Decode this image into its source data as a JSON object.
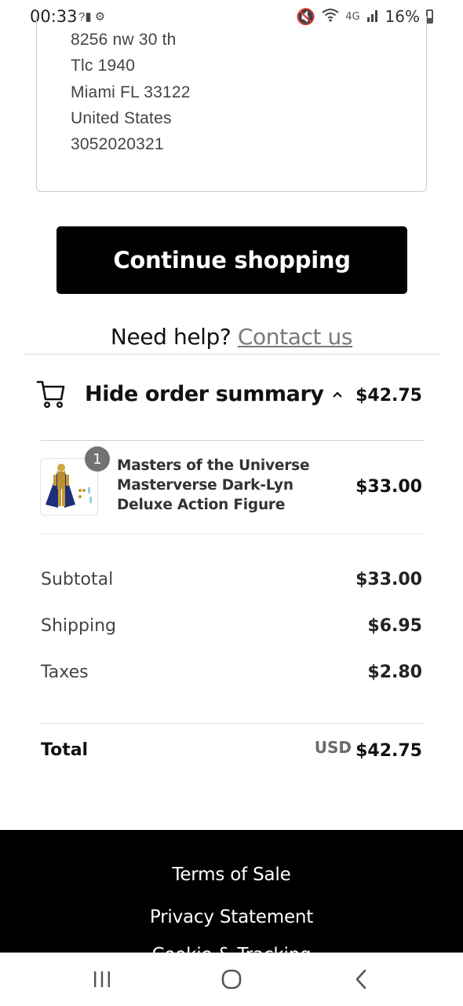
{
  "status_bar": {
    "time": "00:33",
    "battery": "16%",
    "network": "4G"
  },
  "address": {
    "lines": [
      "8256 nw 30 th",
      "Tlc 1940",
      "Miami FL 33122",
      "United States",
      "3052020321"
    ]
  },
  "continue_button": {
    "label": "Continue shopping"
  },
  "help": {
    "prefix": "Need help?",
    "link": "Contact us"
  },
  "order_summary": {
    "toggle_label": "Hide order summary",
    "total": "$42.75"
  },
  "product": {
    "quantity": "1",
    "name": "Masters of the Universe Masterverse Dark-Lyn Deluxe Action Figure",
    "price": "$33.00"
  },
  "totals": {
    "subtotal_label": "Subtotal",
    "subtotal_value": "$33.00",
    "shipping_label": "Shipping",
    "shipping_value": "$6.95",
    "taxes_label": "Taxes",
    "taxes_value": "$2.80",
    "total_label": "Total",
    "currency": "USD",
    "total_value": "$42.75"
  },
  "footer": {
    "links": [
      "Terms of Sale",
      "Privacy Statement",
      "Cookie & Tracking"
    ]
  },
  "colors": {
    "button_bg": "#000000",
    "link_gray": "#7a7a7a",
    "footer_bg": "#000000"
  }
}
